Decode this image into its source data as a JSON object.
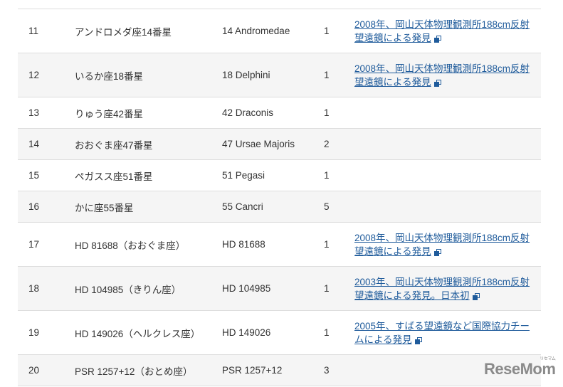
{
  "rows": [
    {
      "no": "11",
      "name": "アンドロメダ座14番星",
      "latin": "14 Andromedae",
      "count": "1",
      "note": "2008年、岡山天体物理観測所188cm反射望遠鏡による発見"
    },
    {
      "no": "12",
      "name": "いるか座18番星",
      "latin": "18 Delphini",
      "count": "1",
      "note": "2008年、岡山天体物理観測所188cm反射望遠鏡による発見"
    },
    {
      "no": "13",
      "name": "りゅう座42番星",
      "latin": "42 Draconis",
      "count": "1",
      "note": ""
    },
    {
      "no": "14",
      "name": "おおぐま座47番星",
      "latin": "47 Ursae Majoris",
      "count": "2",
      "note": ""
    },
    {
      "no": "15",
      "name": "ペガスス座51番星",
      "latin": "51 Pegasi",
      "count": "1",
      "note": ""
    },
    {
      "no": "16",
      "name": "かに座55番星",
      "latin": "55 Cancri",
      "count": "5",
      "note": ""
    },
    {
      "no": "17",
      "name": "HD 81688（おおぐま座）",
      "latin": "HD 81688",
      "count": "1",
      "note": "2008年、岡山天体物理観測所188cm反射望遠鏡による発見"
    },
    {
      "no": "18",
      "name": "HD 104985（きりん座）",
      "latin": "HD 104985",
      "count": "1",
      "note": "2003年、岡山天体物理観測所188cm反射望遠鏡による発見。日本初"
    },
    {
      "no": "19",
      "name": "HD 149026（ヘルクレス座）",
      "latin": "HD 149026",
      "count": "1",
      "note": "2005年、すばる望遠鏡など国際協力チームによる発見"
    },
    {
      "no": "20",
      "name": "PSR 1257+12（おとめ座）",
      "latin": "PSR 1257+12",
      "count": "3",
      "note": ""
    }
  ],
  "watermark": {
    "text": "ReseMom",
    "kana": "リセマム"
  },
  "colors": {
    "link": "#1f5b9b",
    "stripe": "#f5f5f5"
  }
}
